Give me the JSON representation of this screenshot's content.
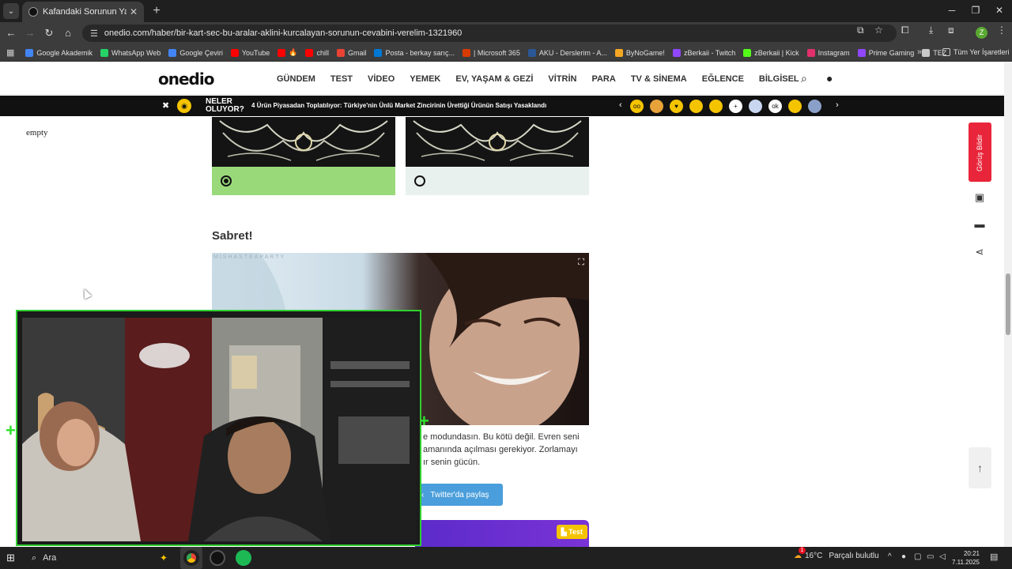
{
  "browser": {
    "tab_title": "Kafandaki Sorunun Yanıtı Bu Kart",
    "url": "onedio.com/haber/bir-kart-sec-bu-aralar-aklini-kurcalayan-sorunun-cevabini-verelim-1321960",
    "profile_initial": "Z"
  },
  "bookmarks": [
    {
      "label": "Google Akademik",
      "color": "#4285f4"
    },
    {
      "label": "WhatsApp Web",
      "color": "#25d366"
    },
    {
      "label": "Google Çeviri",
      "color": "#4285f4"
    },
    {
      "label": "YouTube",
      "color": "#ff0000"
    },
    {
      "label": "🔥",
      "color": "#ff0000"
    },
    {
      "label": "chill",
      "color": "#ff0000"
    },
    {
      "label": "Gmail",
      "color": "#ea4335"
    },
    {
      "label": "Posta - berkay sarıç...",
      "color": "#0078d4"
    },
    {
      "label": "| Microsoft 365",
      "color": "#d83b01"
    },
    {
      "label": "AKU - Derslerim - A...",
      "color": "#2b5797"
    },
    {
      "label": "ByNoGame!",
      "color": "#f5a623"
    },
    {
      "label": "zBerkaii - Twitch",
      "color": "#9146ff"
    },
    {
      "label": "zBerkaii | Kick",
      "color": "#53fc18"
    },
    {
      "label": "Instagram",
      "color": "#e1306c"
    },
    {
      "label": "Prime Gaming",
      "color": "#9146ff"
    },
    {
      "label": "TEZ",
      "color": "#c8c8c8"
    }
  ],
  "bookmarks_all": "Tüm Yer İşaretleri",
  "site": {
    "logo": "onedio",
    "menu": [
      "GÜNDEM",
      "TEST",
      "VİDEO",
      "YEMEK",
      "EV, YAŞAM & GEZİ",
      "VİTRİN",
      "PARA",
      "TV & SİNEMA",
      "EĞLENCE",
      "BİLGİSEL"
    ]
  },
  "trendbar": {
    "neler_line1": "NELER",
    "neler_line2": "OLUYOR?",
    "headline": "4 Ürün Piyasadan Toplatılıyor: Türkiye'nin Ünlü Market Zincirinin Ürettiği Ürünün Satışı Yasaklandı",
    "emojis": [
      {
        "glyph": "oo",
        "color": "#f5c400"
      },
      {
        "glyph": "",
        "color": "#e8a23a"
      },
      {
        "glyph": "♥",
        "color": "#f5c400"
      },
      {
        "glyph": "",
        "color": "#f5c400"
      },
      {
        "glyph": "",
        "color": "#f5c400"
      },
      {
        "glyph": "+",
        "color": "#ffffff"
      },
      {
        "glyph": "",
        "color": "#c9d6f0"
      },
      {
        "glyph": "ok",
        "color": "#ffffff"
      },
      {
        "glyph": "",
        "color": "#f5c400"
      },
      {
        "glyph": "",
        "color": "#8aa0c8"
      }
    ]
  },
  "sidebar_left_text": "empty",
  "quiz": {
    "option_a_selected": true,
    "option_b_selected": false
  },
  "result": {
    "title": "Sabret!",
    "watermark": "MISHASTEAPARTY",
    "text_lines": [
      "e modundasın. Bu kötü değil. Evren seni",
      "amanında açılması gerekiyor. Zorlamayı",
      "ır senin gücün."
    ],
    "share_label": "Twitter'da paylaş",
    "test_badge": "Test"
  },
  "right_rail": {
    "feedback_label": "Görüş Bildir"
  },
  "taskbar": {
    "search_label": "Ara",
    "weather_temp": "16°C",
    "weather_desc": "Parçalı bulutlu",
    "time": "20:21",
    "date": "7.11.2025",
    "weather_badge": "1"
  }
}
